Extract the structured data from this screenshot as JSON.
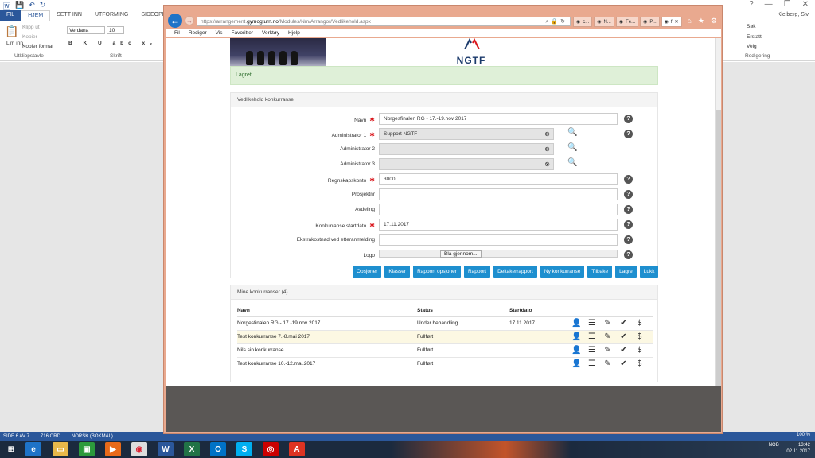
{
  "word": {
    "title_right": [
      "?",
      "—",
      "❐",
      "✕"
    ],
    "tabs": [
      "FIL",
      "HJEM",
      "SETT INN",
      "UTFORMING",
      "SIDEOPPSETT"
    ],
    "user": "Kleiberg, Siv",
    "clipboard": {
      "paste": "Lim inn",
      "cut": "Klipp ut",
      "copy": "Kopier",
      "format_painter": "Kopier format",
      "group": "Utklippstavle"
    },
    "font": {
      "name": "Verdana",
      "size": "10",
      "group": "Skrift"
    },
    "editing": {
      "find": "Søk",
      "replace": "Erstatt",
      "select": "Velg",
      "group": "Redigering"
    },
    "status": {
      "page": "SIDE 6 AV 7",
      "words": "716 ORD",
      "lang": "NORSK (BOKMÅL)",
      "zoom": "100 %"
    }
  },
  "browser": {
    "url_prefix": "https://arrangement.",
    "url_host": "gymogturn.no",
    "url_path": "/Modules/Nm/Arrangor/Vedlikehold.aspx",
    "tabs": [
      {
        "label": "c...",
        "active": false
      },
      {
        "label": "N...",
        "active": false
      },
      {
        "label": "Fe...",
        "active": false
      },
      {
        "label": "P...",
        "active": false
      },
      {
        "label": "f",
        "active": true
      }
    ],
    "menu": [
      "Fil",
      "Rediger",
      "Vis",
      "Favoritter",
      "Verktøy",
      "Hjelp"
    ]
  },
  "page": {
    "logo_text": "NGTF",
    "alert": "Lagret",
    "form_title": "Vedlikehold konkurranse",
    "fields": [
      {
        "label": "Navn",
        "required": true,
        "value": "Norgesfinalen RG - 17.-19.nov 2017",
        "type": "text"
      },
      {
        "label": "Administrator 1",
        "required": true,
        "value": "Support NGTF",
        "type": "lookup"
      },
      {
        "label": "Administrator 2",
        "required": false,
        "value": "",
        "type": "lookup"
      },
      {
        "label": "Administrator 3",
        "required": false,
        "value": "",
        "type": "lookup"
      },
      {
        "label": "Regnskapskonto",
        "required": true,
        "value": "3000",
        "type": "text"
      },
      {
        "label": "Prosjektnr",
        "required": false,
        "value": "",
        "type": "text"
      },
      {
        "label": "Avdeling",
        "required": false,
        "value": "",
        "type": "text"
      },
      {
        "label": "Konkurranse startdato",
        "required": true,
        "value": "17.11.2017",
        "type": "text"
      },
      {
        "label": "Ekstrakostnad ved etteranmelding",
        "required": false,
        "value": "",
        "type": "text"
      },
      {
        "label": "Logo",
        "required": false,
        "value": "Bla gjennom...",
        "type": "file"
      }
    ],
    "buttons": [
      "Opsjoner",
      "Klasser",
      "Rapport opsjoner",
      "Rapport",
      "Deltakerrapport",
      "Ny konkurranse",
      "Tilbake",
      "Lagre",
      "Lukk"
    ],
    "list_title": "Mine konkurranser (4)",
    "columns": [
      "Navn",
      "Status",
      "Startdato"
    ],
    "rows": [
      {
        "name": "Norgesfinalen RG - 17.-19.nov 2017",
        "status": "Under behandling",
        "date": "17.11.2017"
      },
      {
        "name": "Test konkurranse 7.-8.mai 2017",
        "status": "Fullført",
        "date": ""
      },
      {
        "name": "Nils sin konkurranse",
        "status": "Fullført",
        "date": ""
      },
      {
        "name": "Test konkurranse 10.-12.mai.2017",
        "status": "Fullført",
        "date": ""
      }
    ]
  },
  "tray": {
    "lang": "NOB",
    "time": "13:42",
    "date": "02.11.2017"
  },
  "colors": {
    "accent_button": "#1e8fcf",
    "alert_bg": "#dff0d8",
    "word_blue": "#2b579a",
    "browser_frame": "#e9a98f"
  }
}
